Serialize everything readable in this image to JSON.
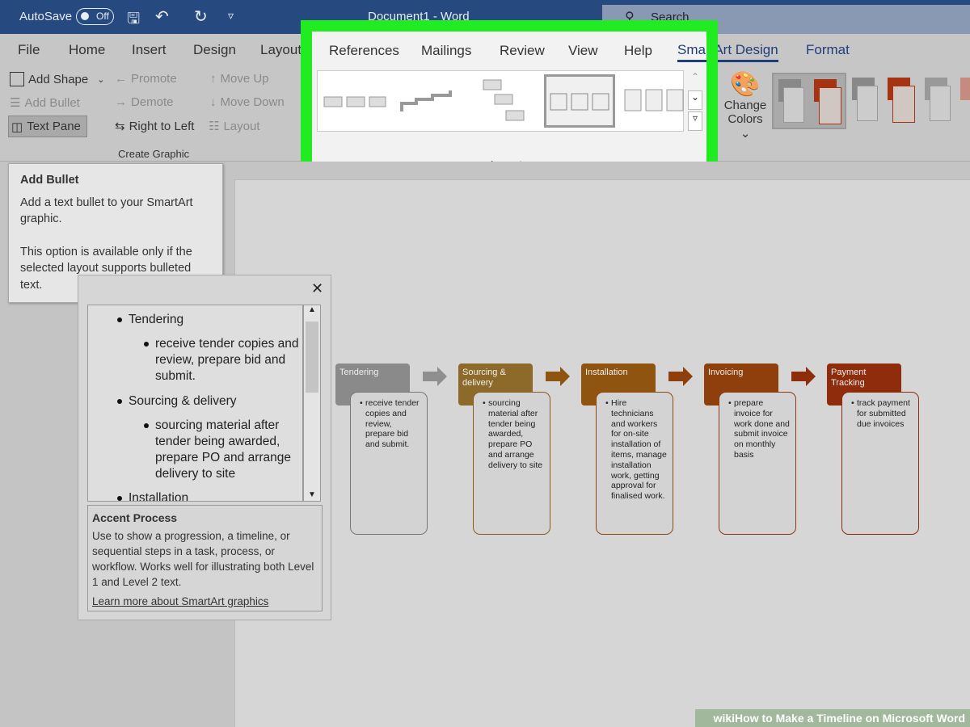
{
  "titlebar": {
    "autosave_label": "AutoSave",
    "autosave_state": "Off",
    "doc_title": "Document1  -  Word",
    "search_placeholder": "Search"
  },
  "tabs": [
    "File",
    "Home",
    "Insert",
    "Design",
    "Layout",
    "References",
    "Mailings",
    "Review",
    "View",
    "Help",
    "SmartArt Design",
    "Format"
  ],
  "active_tab": "SmartArt Design",
  "create_graphic": {
    "add_shape": "Add Shape",
    "add_bullet": "Add Bullet",
    "text_pane": "Text Pane",
    "promote": "Promote",
    "demote": "Demote",
    "right_to_left": "Right to Left",
    "move_up": "Move Up",
    "move_down": "Move Down",
    "layout": "Layout",
    "group_label": "Create Graphic"
  },
  "layouts": {
    "group_label": "Layouts"
  },
  "change_colors": {
    "line1": "Change",
    "line2": "Colors"
  },
  "tooltip": {
    "title": "Add Bullet",
    "body1": "Add a text bullet to your SmartArt graphic.",
    "body2": "This option is available only if the selected layout supports bulleted text."
  },
  "text_pane": {
    "items": [
      {
        "level": 1,
        "text": "Tendering"
      },
      {
        "level": 2,
        "text": "receive tender copies and review, prepare bid and submit."
      },
      {
        "level": 1,
        "text": "Sourcing & delivery"
      },
      {
        "level": 2,
        "text": "sourcing material after tender being awarded, prepare PO and arrange delivery to site"
      },
      {
        "level": 1,
        "text": "Installation"
      }
    ],
    "info_title": "Accent Process",
    "info_body": "Use to show a progression, a timeline, or sequential steps in a task, process, or workflow. Works well for illustrating both Level 1 and Level 2 text.",
    "info_link": "Learn more about SmartArt graphics"
  },
  "timeline": [
    {
      "title": "Tendering",
      "detail": "receive tender copies and review, prepare bid and submit.",
      "color": "#8a8a8a",
      "border": "#777777"
    },
    {
      "title": "Sourcing & delivery",
      "detail": "sourcing material after tender being awarded, prepare PO and arrange delivery to site",
      "color": "#8d6a2a",
      "border": "#8d5a20"
    },
    {
      "title": "Installation",
      "detail": "Hire technicians and workers for on-site installation of items, manage installation work, getting approval for finalised work.",
      "color": "#8f5410",
      "border": "#8f4a10"
    },
    {
      "title": "Invoicing",
      "detail": "prepare invoice for work done and submit invoice on monthly basis",
      "color": "#8e3f0c",
      "border": "#8e3a12"
    },
    {
      "title": "Payment Tracking",
      "detail": "track payment for submitted due invoices",
      "color": "#8e2c0c",
      "border": "#8e2a14"
    }
  ],
  "accent": {
    "highlight": "#21ec21",
    "titlebar": "#264a7f"
  },
  "watermark": "wikiHow to Make a Timeline on Microsoft Word"
}
